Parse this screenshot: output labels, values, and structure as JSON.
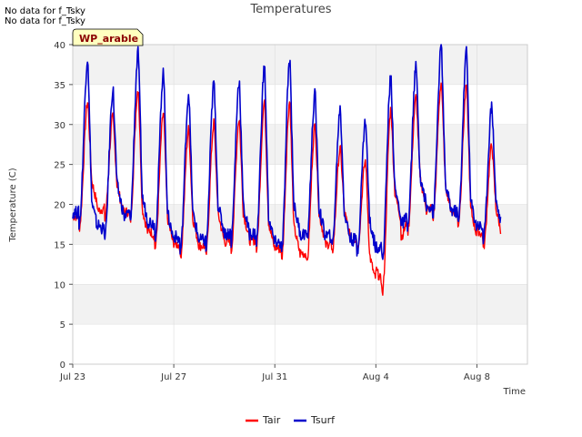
{
  "notes": [
    "No data for f_Tsky",
    "No data for f_Tsky"
  ],
  "site_label": "WP_arable",
  "colors": {
    "Tair": "#ff0000",
    "Tsurf": "#0000cc",
    "band": "#f2f2f2",
    "grid": "#dddddd",
    "site_fill": "#ffffc0"
  },
  "chart_data": {
    "type": "line",
    "title": "Temperatures",
    "xlabel": "Time",
    "ylabel": "Temperature (C)",
    "ylim": [
      0,
      40
    ],
    "yticks": [
      0,
      5,
      10,
      15,
      20,
      25,
      30,
      35,
      40
    ],
    "xlim_days": [
      0,
      18
    ],
    "xticks": [
      {
        "day": 0,
        "label": "Jul 23"
      },
      {
        "day": 4,
        "label": "Jul 27"
      },
      {
        "day": 8,
        "label": "Jul 31"
      },
      {
        "day": 12,
        "label": "Aug 4"
      },
      {
        "day": 16,
        "label": "Aug 8"
      }
    ],
    "legend_position": "bottom-center",
    "series": [
      {
        "name": "Tair",
        "daily_max": [
          32.9,
          31.0,
          34.6,
          31.5,
          29.5,
          30.3,
          30.8,
          33.0,
          33.0,
          30.0,
          27.0,
          25.5,
          32.0,
          33.5,
          35.3,
          34.8,
          27.5
        ],
        "daily_min": [
          17.0,
          18.0,
          17.5,
          14.5,
          13.3,
          13.3,
          13.9,
          14.0,
          12.8,
          12.3,
          13.8,
          14.2,
          8.7,
          16.5,
          18.2,
          17.5,
          14.5
        ]
      },
      {
        "name": "Tsurf",
        "daily_max": [
          38.4,
          34.4,
          39.1,
          36.7,
          33.9,
          35.3,
          35.6,
          37.3,
          38.3,
          33.8,
          32.0,
          30.6,
          36.0,
          37.3,
          39.8,
          39.3,
          32.5
        ],
        "daily_min": [
          17.5,
          15.3,
          17.5,
          16.0,
          14.0,
          14.0,
          15.0,
          14.8,
          13.5,
          15.0,
          14.5,
          14.0,
          13.0,
          17.0,
          18.5,
          17.5,
          15.5
        ]
      }
    ]
  }
}
